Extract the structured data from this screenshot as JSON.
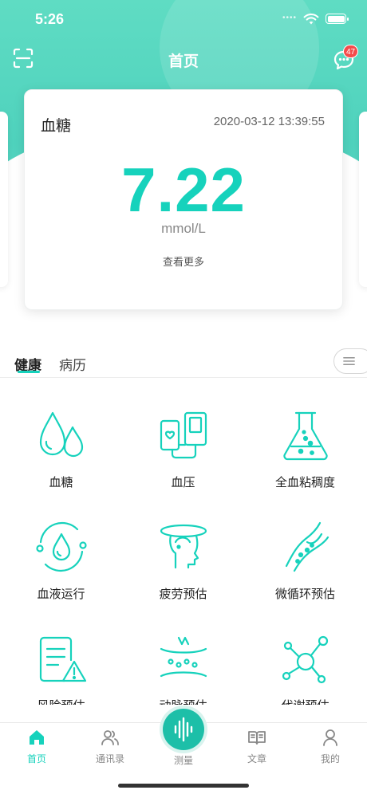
{
  "status_bar": {
    "time": "5:26"
  },
  "nav": {
    "title": "首页",
    "message_badge": "47"
  },
  "card": {
    "title": "血糖",
    "timestamp": "2020-03-12 13:39:55",
    "value": "7.22",
    "unit": "mmol/L",
    "more_label": "查看更多"
  },
  "tabs": [
    {
      "label": "健康",
      "active": true
    },
    {
      "label": "病历",
      "active": false
    }
  ],
  "grid": {
    "items": [
      {
        "label": "血糖",
        "icon": "blood-drops-icon"
      },
      {
        "label": "血压",
        "icon": "blood-pressure-monitor-icon"
      },
      {
        "label": "全血粘稠度",
        "icon": "flask-icon"
      },
      {
        "label": "血液运行",
        "icon": "blood-circulation-icon"
      },
      {
        "label": "疲劳预估",
        "icon": "fatigue-head-icon"
      },
      {
        "label": "微循环预估",
        "icon": "microcirculation-icon"
      },
      {
        "label": "风险预估",
        "icon": "risk-document-icon"
      },
      {
        "label": "动脉预估",
        "icon": "artery-icon"
      },
      {
        "label": "代谢预估",
        "icon": "metabolism-molecule-icon"
      }
    ]
  },
  "bottom_nav": {
    "items": [
      {
        "label": "首页",
        "icon": "home-icon",
        "active": true
      },
      {
        "label": "通讯录",
        "icon": "contacts-icon",
        "active": false
      },
      {
        "label": "测量",
        "icon": "measure-wave-icon",
        "active": false
      },
      {
        "label": "文章",
        "icon": "book-icon",
        "active": false
      },
      {
        "label": "我的",
        "icon": "profile-icon",
        "active": false
      }
    ]
  },
  "colors": {
    "accent": "#16d2bc",
    "header": "#5fdcc3",
    "badge": "#f44b4b"
  }
}
